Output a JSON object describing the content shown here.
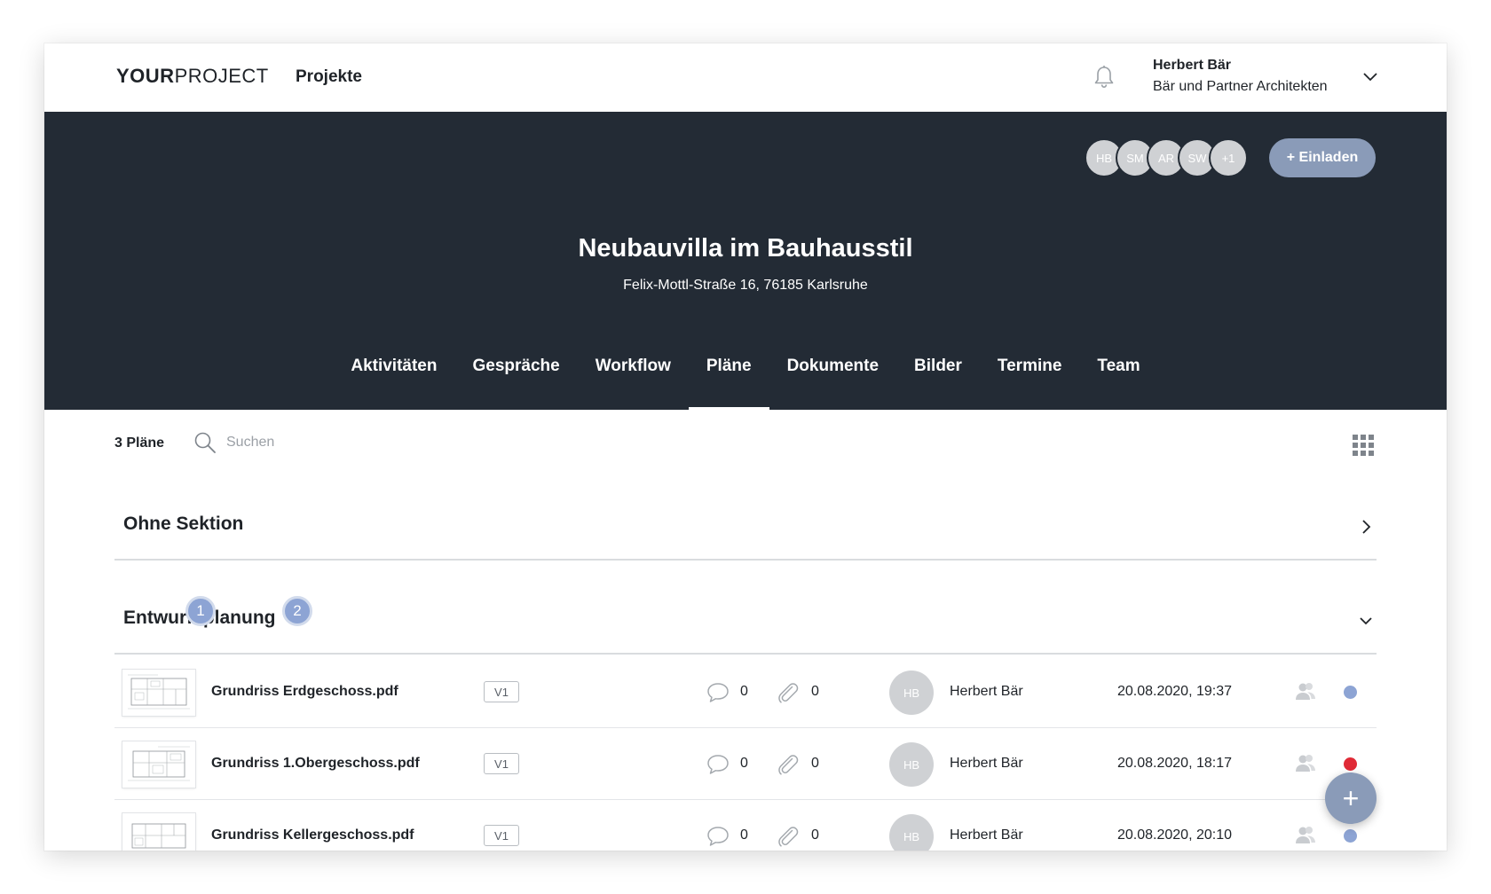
{
  "app": {
    "logo_bold": "YOUR",
    "logo_light": "PROJECT",
    "nav_projects": "Projekte"
  },
  "user": {
    "name": "Herbert Bär",
    "org": "Bär und Partner Architekten"
  },
  "project": {
    "title": "Neubauvilla im Bauhausstil",
    "address": "Felix-Mottl-Straße 16, 76185 Karlsruhe",
    "members": [
      "HB",
      "SM",
      "AR",
      "SW",
      "+1"
    ],
    "invite_label": "+ Einladen"
  },
  "tabs": [
    {
      "label": "Aktivitäten",
      "active": false
    },
    {
      "label": "Gespräche",
      "active": false
    },
    {
      "label": "Workflow",
      "active": false
    },
    {
      "label": "Pläne",
      "active": true
    },
    {
      "label": "Dokumente",
      "active": false
    },
    {
      "label": "Bilder",
      "active": false
    },
    {
      "label": "Termine",
      "active": false
    },
    {
      "label": "Team",
      "active": false
    }
  ],
  "toolbar": {
    "count": "3 Pläne",
    "search_placeholder": "Suchen"
  },
  "sections": [
    {
      "title": "Ohne Sektion",
      "expanded": false
    },
    {
      "title": "Entwurfsplanung",
      "expanded": true
    }
  ],
  "markers": [
    "1",
    "2"
  ],
  "plans": [
    {
      "name": "Grundriss Erdgeschoss.pdf",
      "version": "V1",
      "comments": "0",
      "attachments": "0",
      "author_initials": "HB",
      "author": "Herbert Bär",
      "date": "20.08.2020, 19:37",
      "status_color": "#8da4d4"
    },
    {
      "name": "Grundriss 1.Obergeschoss.pdf",
      "version": "V1",
      "comments": "0",
      "attachments": "0",
      "author_initials": "HB",
      "author": "Herbert Bär",
      "date": "20.08.2020, 18:17",
      "status_color": "#e02a36"
    },
    {
      "name": "Grundriss Kellergeschoss.pdf",
      "version": "V1",
      "comments": "0",
      "attachments": "0",
      "author_initials": "HB",
      "author": "Herbert Bär",
      "date": "20.08.2020, 20:10",
      "status_color": "#8da4d4"
    }
  ],
  "fab_label": "+",
  "colors": {
    "hero_bg": "#232b35",
    "accent": "#8a9bb8",
    "marker": "#8da4d4"
  }
}
